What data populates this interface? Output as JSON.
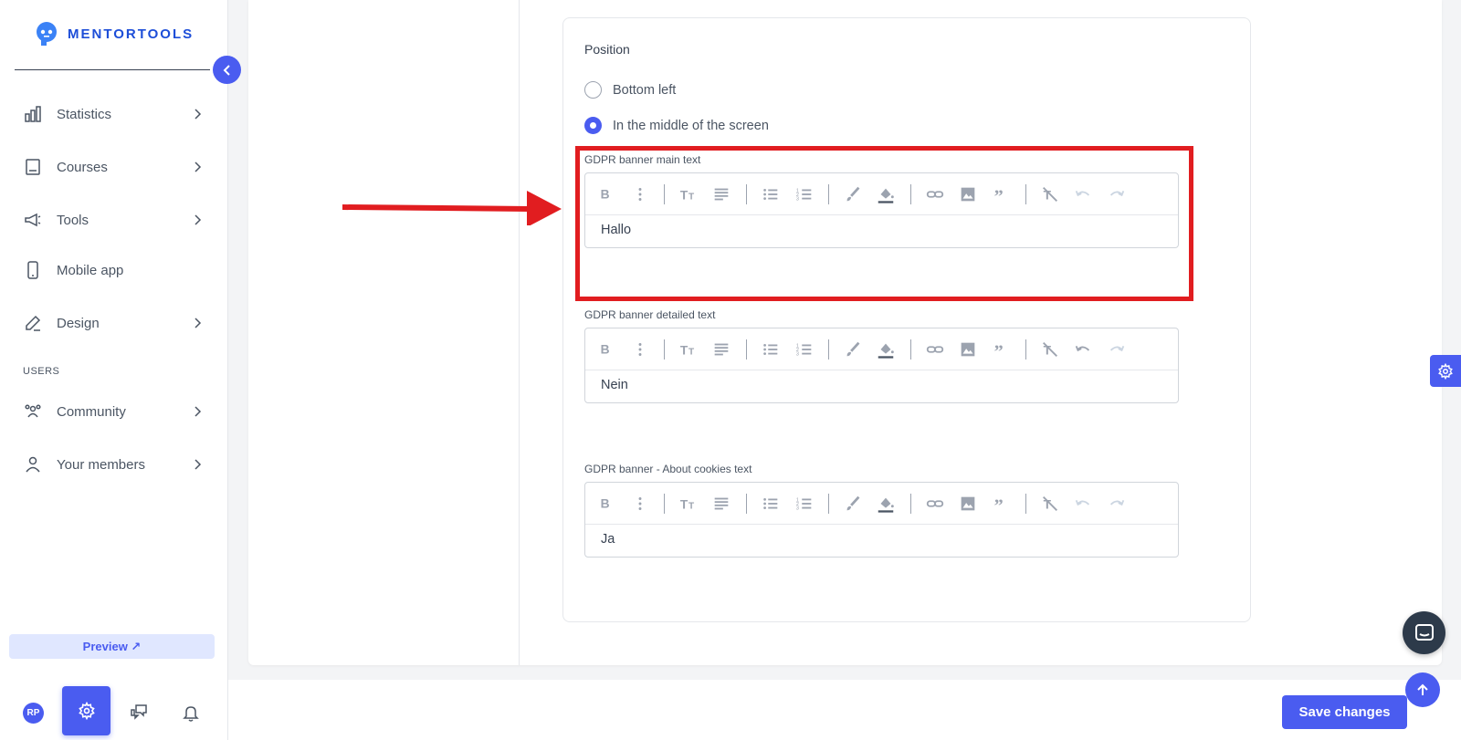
{
  "app": {
    "logo_text": "MENTORTOOLS"
  },
  "sidebar": {
    "items": [
      {
        "label": "Statistics",
        "icon": "bar-chart-icon",
        "has_chevron": true
      },
      {
        "label": "Courses",
        "icon": "book-icon",
        "has_chevron": true
      },
      {
        "label": "Tools",
        "icon": "megaphone-icon",
        "has_chevron": true
      },
      {
        "label": "Mobile app",
        "icon": "phone-icon",
        "has_chevron": false
      },
      {
        "label": "Design",
        "icon": "edit-icon",
        "has_chevron": true
      }
    ],
    "section_users": "USERS",
    "user_items": [
      {
        "label": "Community",
        "icon": "people-icon",
        "has_chevron": true
      },
      {
        "label": "Your members",
        "icon": "user-icon",
        "has_chevron": true
      }
    ],
    "preview_label": "Preview ↗",
    "avatar_initials": "RP"
  },
  "position": {
    "title": "Position",
    "options": [
      {
        "label": "Bottom left",
        "checked": false
      },
      {
        "label": "In the middle of the screen",
        "checked": true
      }
    ]
  },
  "editors": [
    {
      "label": "GDPR banner main text",
      "content": "Hallo"
    },
    {
      "label": "GDPR banner detailed text",
      "content": "Nein"
    },
    {
      "label": "GDPR banner - About cookies text",
      "content": "Ja"
    }
  ],
  "footer": {
    "save_label": "Save changes"
  },
  "colors": {
    "accent": "#4a5cf0",
    "highlight": "#e11d20",
    "logo": "#1d4ed8"
  }
}
